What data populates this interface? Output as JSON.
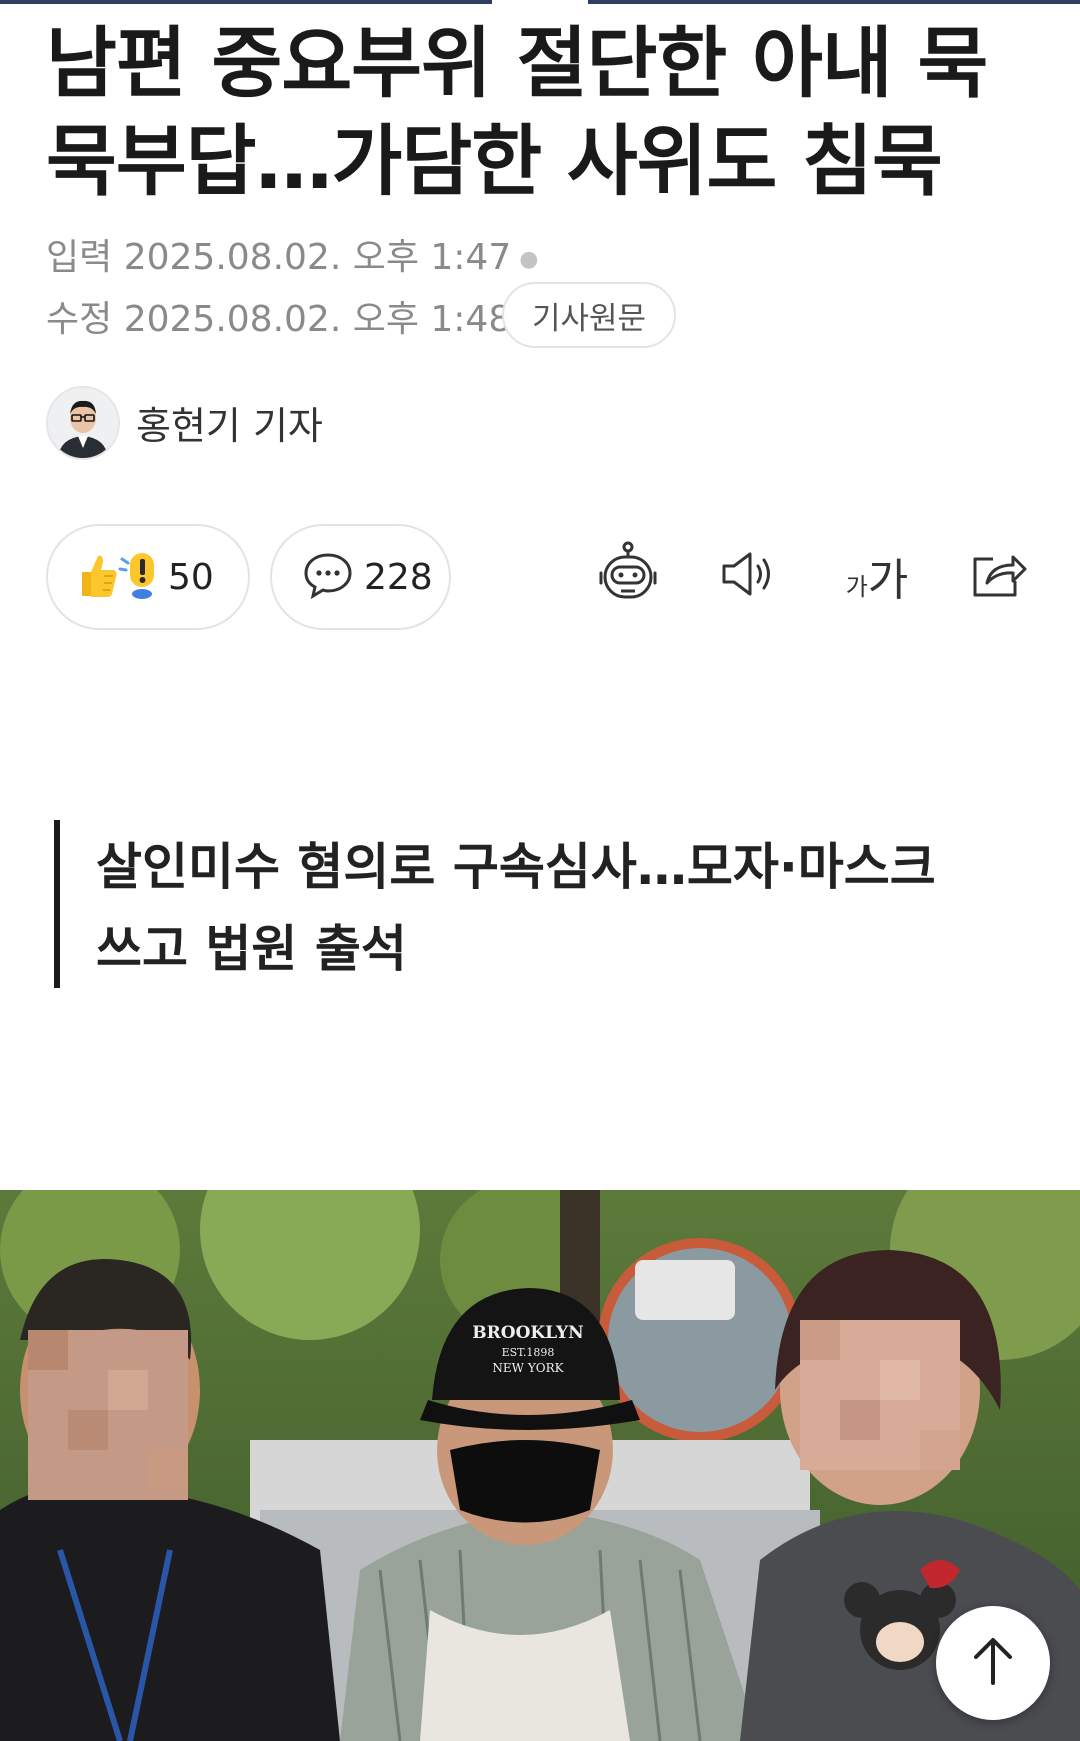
{
  "article": {
    "headline": "남편 중요부위 절단한 아내 묵묵부답…가담한 사위도 침묵",
    "input_label": "입력",
    "input_datetime": "2025.08.02. 오후 1:47",
    "modified_label": "수정",
    "modified_datetime": "2025.08.02. 오후 1:48",
    "original_button": "기사원문",
    "reporter": "홍현기 기자",
    "subtitle": "살인미수 혐의로 구속심사…모자·마스크 쓰고 법원 출석"
  },
  "actions": {
    "reaction_count": "50",
    "comment_count": "228",
    "font_size_label_small": "가",
    "font_size_label_large": "가"
  },
  "photo": {
    "cap_text_line1": "BROOKLYN",
    "cap_text_line2": "EST.1898",
    "cap_text_line3": "NEW YORK"
  },
  "icons": [
    "thumbs-up-icon",
    "exclamation-icon",
    "comment-icon",
    "robot-summary-icon",
    "speaker-icon",
    "font-size-icon",
    "share-icon",
    "arrow-up-icon"
  ],
  "colors": {
    "progress_bar": "#2f3f5e",
    "text_primary": "#1a1a1a",
    "meta_gray": "#8a8a8a"
  }
}
